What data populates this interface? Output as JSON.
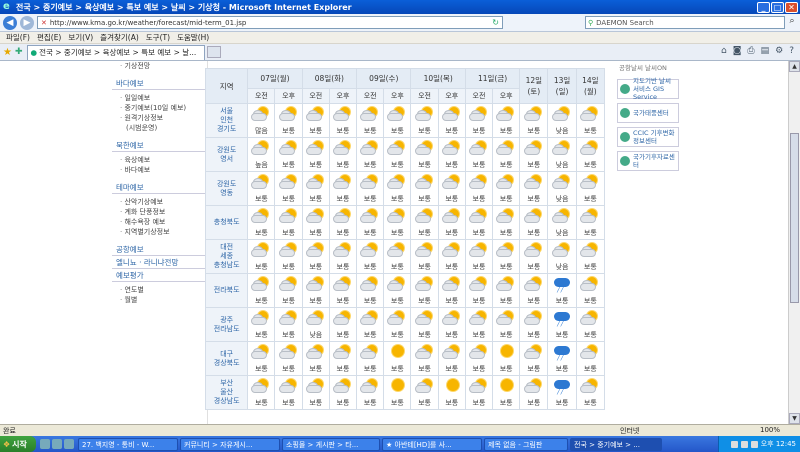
{
  "window": {
    "title": "전국 > 중기예보 > 육상예보 > 특보 예보 > 날씨 > 기상청 - Microsoft Internet Explorer",
    "minimize": "_",
    "maximize": "□",
    "close": "✕"
  },
  "address": {
    "url": "http://www.kma.go.kr/weather/forecast/mid-term_01.jsp",
    "search_placeholder": "DAEMON Search"
  },
  "menu": [
    "파일(F)",
    "편집(E)",
    "보기(V)",
    "즐겨찾기(A)",
    "도구(T)",
    "도움말(H)"
  ],
  "tab": {
    "label": "전국 > 중기예보 > 육상예보 > 특보 예보 > 날..."
  },
  "sidebar": {
    "top_item": "기상전망",
    "sections": [
      {
        "heading": "바다예보",
        "items": [
          "일일예보",
          "중기예보(10일 예보)",
          "원격기상정보",
          "(시범운영)"
        ]
      },
      {
        "heading": "북한예보",
        "items": [
          "육상예보",
          "바다예보"
        ]
      },
      {
        "heading": "테마예보",
        "items": [
          "산악기상예보",
          "계화 단풍정보",
          "해수욕장 예보",
          "지역별기상정보"
        ]
      },
      {
        "heading": "공항예보",
        "items": []
      },
      {
        "heading": "엘니뇨 · 라니냐전망",
        "items": []
      },
      {
        "heading": "예보평가",
        "items": [
          "연도별",
          "월별"
        ]
      }
    ]
  },
  "forecast": {
    "region_header": "지역",
    "days": [
      {
        "label": "07일(월)",
        "split": true
      },
      {
        "label": "08일(화)",
        "split": true
      },
      {
        "label": "09일(수)",
        "split": true
      },
      {
        "label": "10일(목)",
        "split": true
      },
      {
        "label": "11일(금)",
        "split": true
      },
      {
        "label": "12일(토)",
        "split": false
      },
      {
        "label": "13일(일)",
        "split": false
      },
      {
        "label": "14일(월)",
        "split": false
      }
    ],
    "am_label": "오전",
    "pm_label": "오후",
    "rows": [
      {
        "region": [
          "서울",
          "인천",
          "경기도"
        ],
        "cells": [
          [
            "sun-cloud",
            "많음"
          ],
          [
            "sun-cloud",
            "보통"
          ],
          [
            "sun-cloud",
            "보통"
          ],
          [
            "sun-cloud",
            "보통"
          ],
          [
            "sun-cloud",
            "보통"
          ],
          [
            "sun-cloud",
            "보통"
          ],
          [
            "sun-cloud",
            "보통"
          ],
          [
            "sun-cloud",
            "보통"
          ],
          [
            "sun-cloud",
            "보통"
          ],
          [
            "sun-cloud",
            "보통"
          ],
          [
            "sun-cloud",
            "보통"
          ],
          [
            "sun-cloud",
            "낮음"
          ],
          [
            "sun-cloud",
            "보통"
          ]
        ]
      },
      {
        "region": [
          "강원도",
          "영서"
        ],
        "cells": [
          [
            "sun-cloud",
            "높음"
          ],
          [
            "sun-cloud",
            "보통"
          ],
          [
            "sun-cloud",
            "보통"
          ],
          [
            "sun-cloud",
            "보통"
          ],
          [
            "sun-cloud",
            "보통"
          ],
          [
            "sun-cloud",
            "보통"
          ],
          [
            "sun-cloud",
            "보통"
          ],
          [
            "sun-cloud",
            "보통"
          ],
          [
            "sun-cloud",
            "보통"
          ],
          [
            "sun-cloud",
            "보통"
          ],
          [
            "sun-cloud",
            "보통"
          ],
          [
            "sun-cloud",
            "낮음"
          ],
          [
            "sun-cloud",
            "보통"
          ]
        ]
      },
      {
        "region": [
          "강원도",
          "영동"
        ],
        "cells": [
          [
            "sun-cloud",
            "보통"
          ],
          [
            "sun-cloud",
            "보통"
          ],
          [
            "sun-cloud",
            "보통"
          ],
          [
            "sun-cloud",
            "보통"
          ],
          [
            "sun-cloud",
            "보통"
          ],
          [
            "sun-cloud",
            "보통"
          ],
          [
            "sun-cloud",
            "보통"
          ],
          [
            "sun-cloud",
            "보통"
          ],
          [
            "sun-cloud",
            "보통"
          ],
          [
            "sun-cloud",
            "보통"
          ],
          [
            "sun-cloud",
            "보통"
          ],
          [
            "sun-cloud",
            "낮음"
          ],
          [
            "sun-cloud",
            "보통"
          ]
        ]
      },
      {
        "region": [
          "충청북도"
        ],
        "cells": [
          [
            "sun-cloud",
            "보통"
          ],
          [
            "sun-cloud",
            "보통"
          ],
          [
            "sun-cloud",
            "보통"
          ],
          [
            "sun-cloud",
            "보통"
          ],
          [
            "sun-cloud",
            "보통"
          ],
          [
            "sun-cloud",
            "보통"
          ],
          [
            "sun-cloud",
            "보통"
          ],
          [
            "sun-cloud",
            "보통"
          ],
          [
            "sun-cloud",
            "보통"
          ],
          [
            "sun-cloud",
            "보통"
          ],
          [
            "sun-cloud",
            "보통"
          ],
          [
            "sun-cloud",
            "낮음"
          ],
          [
            "sun-cloud",
            "보통"
          ]
        ]
      },
      {
        "region": [
          "대전",
          "세종",
          "충청남도"
        ],
        "cells": [
          [
            "sun-cloud",
            "보통"
          ],
          [
            "sun-cloud",
            "보통"
          ],
          [
            "sun-cloud",
            "보통"
          ],
          [
            "sun-cloud",
            "보통"
          ],
          [
            "sun-cloud",
            "보통"
          ],
          [
            "sun-cloud",
            "보통"
          ],
          [
            "sun-cloud",
            "보통"
          ],
          [
            "sun-cloud",
            "보통"
          ],
          [
            "sun-cloud",
            "보통"
          ],
          [
            "sun-cloud",
            "보통"
          ],
          [
            "sun-cloud",
            "보통"
          ],
          [
            "sun-cloud",
            "낮음"
          ],
          [
            "sun-cloud",
            "보통"
          ]
        ]
      },
      {
        "region": [
          "전라북도"
        ],
        "cells": [
          [
            "sun-cloud",
            "보통"
          ],
          [
            "sun-cloud",
            "보통"
          ],
          [
            "sun-cloud",
            "보통"
          ],
          [
            "sun-cloud",
            "보통"
          ],
          [
            "sun-cloud",
            "보통"
          ],
          [
            "sun-cloud",
            "보통"
          ],
          [
            "sun-cloud",
            "보통"
          ],
          [
            "sun-cloud",
            "보통"
          ],
          [
            "sun-cloud",
            "보통"
          ],
          [
            "sun-cloud",
            "보통"
          ],
          [
            "sun-cloud",
            "보통"
          ],
          [
            "rain",
            "보통"
          ],
          [
            "sun-cloud",
            "보통"
          ]
        ]
      },
      {
        "region": [
          "광주",
          "전라남도"
        ],
        "cells": [
          [
            "sun-cloud",
            "보통"
          ],
          [
            "sun-cloud",
            "보통"
          ],
          [
            "sun-cloud",
            "낮음"
          ],
          [
            "sun-cloud",
            "보통"
          ],
          [
            "sun-cloud",
            "보통"
          ],
          [
            "sun-cloud",
            "보통"
          ],
          [
            "sun-cloud",
            "보통"
          ],
          [
            "sun-cloud",
            "보통"
          ],
          [
            "sun-cloud",
            "보통"
          ],
          [
            "sun-cloud",
            "보통"
          ],
          [
            "sun-cloud",
            "보통"
          ],
          [
            "rain",
            "보통"
          ],
          [
            "sun-cloud",
            "보통"
          ]
        ]
      },
      {
        "region": [
          "대구",
          "경상북도"
        ],
        "cells": [
          [
            "sun-cloud",
            "보통"
          ],
          [
            "sun-cloud",
            "보통"
          ],
          [
            "sun-cloud",
            "보통"
          ],
          [
            "sun-cloud",
            "보통"
          ],
          [
            "sun-cloud",
            "보통"
          ],
          [
            "sun",
            "보통"
          ],
          [
            "sun-cloud",
            "보통"
          ],
          [
            "sun-cloud",
            "보통"
          ],
          [
            "sun-cloud",
            "보통"
          ],
          [
            "sun",
            "보통"
          ],
          [
            "sun-cloud",
            "보통"
          ],
          [
            "rain",
            "보통"
          ],
          [
            "sun-cloud",
            "보통"
          ]
        ]
      },
      {
        "region": [
          "부산",
          "울산",
          "경상남도"
        ],
        "cells": [
          [
            "sun-cloud",
            "보통"
          ],
          [
            "sun-cloud",
            "보통"
          ],
          [
            "sun-cloud",
            "보통"
          ],
          [
            "sun-cloud",
            "보통"
          ],
          [
            "sun-cloud",
            "보통"
          ],
          [
            "sun",
            "보통"
          ],
          [
            "sun-cloud",
            "보통"
          ],
          [
            "sun",
            "보통"
          ],
          [
            "sun-cloud",
            "보통"
          ],
          [
            "sun",
            "보통"
          ],
          [
            "sun-cloud",
            "보통"
          ],
          [
            "rain",
            "보통"
          ],
          [
            "sun-cloud",
            "보통"
          ]
        ]
      }
    ]
  },
  "banners": [
    {
      "label": "공항날씨  날씨ON",
      "top": true
    },
    {
      "label": "지도기반 날씨서비스 GIS Service"
    },
    {
      "label": "국가태풍센터"
    },
    {
      "label": "CCIC 기후변화정보센터"
    },
    {
      "label": "국가기후자료센터"
    }
  ],
  "status": {
    "left": "완료",
    "zone": "인터넷",
    "zoom": "100%"
  },
  "taskbar": {
    "start": "시작",
    "tasks": [
      "27. 백지영 - 통비 - W...",
      "커뮤니티 > 자유게시...",
      "소핑몰 > 게시판 > 타...",
      "★ 아반테[HD]를 사...",
      "제목 없음 - 그림판",
      "전국 > 중기예보 > ..."
    ],
    "active_index": 5,
    "clock": "오후 12:45"
  }
}
